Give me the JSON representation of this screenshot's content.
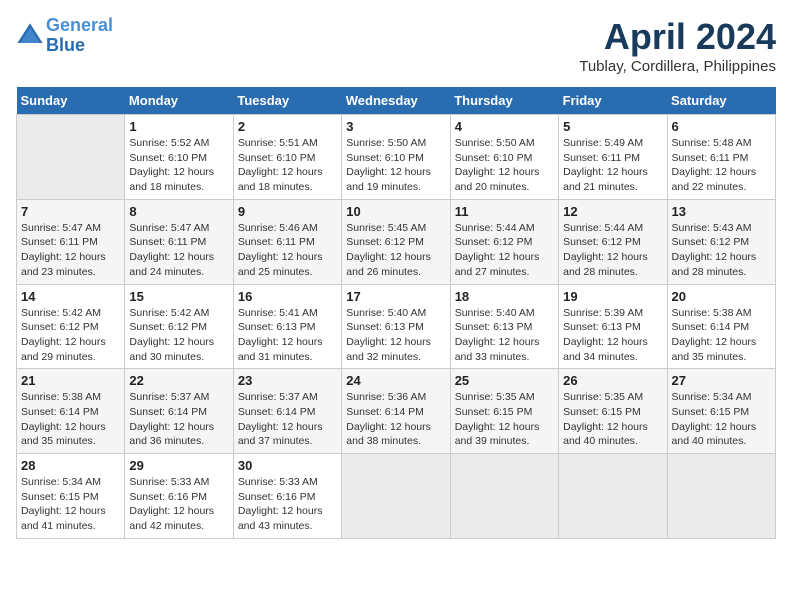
{
  "header": {
    "logo_line1": "General",
    "logo_line2": "Blue",
    "month_title": "April 2024",
    "subtitle": "Tublay, Cordillera, Philippines"
  },
  "weekdays": [
    "Sunday",
    "Monday",
    "Tuesday",
    "Wednesday",
    "Thursday",
    "Friday",
    "Saturday"
  ],
  "weeks": [
    [
      {
        "day": "",
        "sunrise": "",
        "sunset": "",
        "daylight": "",
        "empty": true
      },
      {
        "day": "1",
        "sunrise": "Sunrise: 5:52 AM",
        "sunset": "Sunset: 6:10 PM",
        "daylight": "Daylight: 12 hours and 18 minutes.",
        "empty": false
      },
      {
        "day": "2",
        "sunrise": "Sunrise: 5:51 AM",
        "sunset": "Sunset: 6:10 PM",
        "daylight": "Daylight: 12 hours and 18 minutes.",
        "empty": false
      },
      {
        "day": "3",
        "sunrise": "Sunrise: 5:50 AM",
        "sunset": "Sunset: 6:10 PM",
        "daylight": "Daylight: 12 hours and 19 minutes.",
        "empty": false
      },
      {
        "day": "4",
        "sunrise": "Sunrise: 5:50 AM",
        "sunset": "Sunset: 6:10 PM",
        "daylight": "Daylight: 12 hours and 20 minutes.",
        "empty": false
      },
      {
        "day": "5",
        "sunrise": "Sunrise: 5:49 AM",
        "sunset": "Sunset: 6:11 PM",
        "daylight": "Daylight: 12 hours and 21 minutes.",
        "empty": false
      },
      {
        "day": "6",
        "sunrise": "Sunrise: 5:48 AM",
        "sunset": "Sunset: 6:11 PM",
        "daylight": "Daylight: 12 hours and 22 minutes.",
        "empty": false
      }
    ],
    [
      {
        "day": "7",
        "sunrise": "Sunrise: 5:47 AM",
        "sunset": "Sunset: 6:11 PM",
        "daylight": "Daylight: 12 hours and 23 minutes.",
        "empty": false
      },
      {
        "day": "8",
        "sunrise": "Sunrise: 5:47 AM",
        "sunset": "Sunset: 6:11 PM",
        "daylight": "Daylight: 12 hours and 24 minutes.",
        "empty": false
      },
      {
        "day": "9",
        "sunrise": "Sunrise: 5:46 AM",
        "sunset": "Sunset: 6:11 PM",
        "daylight": "Daylight: 12 hours and 25 minutes.",
        "empty": false
      },
      {
        "day": "10",
        "sunrise": "Sunrise: 5:45 AM",
        "sunset": "Sunset: 6:12 PM",
        "daylight": "Daylight: 12 hours and 26 minutes.",
        "empty": false
      },
      {
        "day": "11",
        "sunrise": "Sunrise: 5:44 AM",
        "sunset": "Sunset: 6:12 PM",
        "daylight": "Daylight: 12 hours and 27 minutes.",
        "empty": false
      },
      {
        "day": "12",
        "sunrise": "Sunrise: 5:44 AM",
        "sunset": "Sunset: 6:12 PM",
        "daylight": "Daylight: 12 hours and 28 minutes.",
        "empty": false
      },
      {
        "day": "13",
        "sunrise": "Sunrise: 5:43 AM",
        "sunset": "Sunset: 6:12 PM",
        "daylight": "Daylight: 12 hours and 28 minutes.",
        "empty": false
      }
    ],
    [
      {
        "day": "14",
        "sunrise": "Sunrise: 5:42 AM",
        "sunset": "Sunset: 6:12 PM",
        "daylight": "Daylight: 12 hours and 29 minutes.",
        "empty": false
      },
      {
        "day": "15",
        "sunrise": "Sunrise: 5:42 AM",
        "sunset": "Sunset: 6:12 PM",
        "daylight": "Daylight: 12 hours and 30 minutes.",
        "empty": false
      },
      {
        "day": "16",
        "sunrise": "Sunrise: 5:41 AM",
        "sunset": "Sunset: 6:13 PM",
        "daylight": "Daylight: 12 hours and 31 minutes.",
        "empty": false
      },
      {
        "day": "17",
        "sunrise": "Sunrise: 5:40 AM",
        "sunset": "Sunset: 6:13 PM",
        "daylight": "Daylight: 12 hours and 32 minutes.",
        "empty": false
      },
      {
        "day": "18",
        "sunrise": "Sunrise: 5:40 AM",
        "sunset": "Sunset: 6:13 PM",
        "daylight": "Daylight: 12 hours and 33 minutes.",
        "empty": false
      },
      {
        "day": "19",
        "sunrise": "Sunrise: 5:39 AM",
        "sunset": "Sunset: 6:13 PM",
        "daylight": "Daylight: 12 hours and 34 minutes.",
        "empty": false
      },
      {
        "day": "20",
        "sunrise": "Sunrise: 5:38 AM",
        "sunset": "Sunset: 6:14 PM",
        "daylight": "Daylight: 12 hours and 35 minutes.",
        "empty": false
      }
    ],
    [
      {
        "day": "21",
        "sunrise": "Sunrise: 5:38 AM",
        "sunset": "Sunset: 6:14 PM",
        "daylight": "Daylight: 12 hours and 35 minutes.",
        "empty": false
      },
      {
        "day": "22",
        "sunrise": "Sunrise: 5:37 AM",
        "sunset": "Sunset: 6:14 PM",
        "daylight": "Daylight: 12 hours and 36 minutes.",
        "empty": false
      },
      {
        "day": "23",
        "sunrise": "Sunrise: 5:37 AM",
        "sunset": "Sunset: 6:14 PM",
        "daylight": "Daylight: 12 hours and 37 minutes.",
        "empty": false
      },
      {
        "day": "24",
        "sunrise": "Sunrise: 5:36 AM",
        "sunset": "Sunset: 6:14 PM",
        "daylight": "Daylight: 12 hours and 38 minutes.",
        "empty": false
      },
      {
        "day": "25",
        "sunrise": "Sunrise: 5:35 AM",
        "sunset": "Sunset: 6:15 PM",
        "daylight": "Daylight: 12 hours and 39 minutes.",
        "empty": false
      },
      {
        "day": "26",
        "sunrise": "Sunrise: 5:35 AM",
        "sunset": "Sunset: 6:15 PM",
        "daylight": "Daylight: 12 hours and 40 minutes.",
        "empty": false
      },
      {
        "day": "27",
        "sunrise": "Sunrise: 5:34 AM",
        "sunset": "Sunset: 6:15 PM",
        "daylight": "Daylight: 12 hours and 40 minutes.",
        "empty": false
      }
    ],
    [
      {
        "day": "28",
        "sunrise": "Sunrise: 5:34 AM",
        "sunset": "Sunset: 6:15 PM",
        "daylight": "Daylight: 12 hours and 41 minutes.",
        "empty": false
      },
      {
        "day": "29",
        "sunrise": "Sunrise: 5:33 AM",
        "sunset": "Sunset: 6:16 PM",
        "daylight": "Daylight: 12 hours and 42 minutes.",
        "empty": false
      },
      {
        "day": "30",
        "sunrise": "Sunrise: 5:33 AM",
        "sunset": "Sunset: 6:16 PM",
        "daylight": "Daylight: 12 hours and 43 minutes.",
        "empty": false
      },
      {
        "day": "",
        "sunrise": "",
        "sunset": "",
        "daylight": "",
        "empty": true
      },
      {
        "day": "",
        "sunrise": "",
        "sunset": "",
        "daylight": "",
        "empty": true
      },
      {
        "day": "",
        "sunrise": "",
        "sunset": "",
        "daylight": "",
        "empty": true
      },
      {
        "day": "",
        "sunrise": "",
        "sunset": "",
        "daylight": "",
        "empty": true
      }
    ]
  ]
}
